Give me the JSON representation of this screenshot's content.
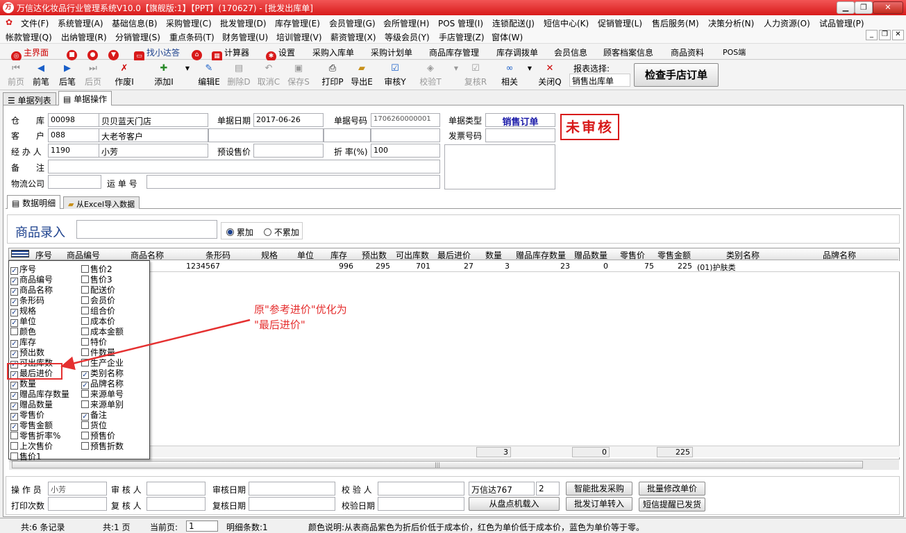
{
  "title": "万信达化妆品行业管理系统V10.0【旗舰版:1】【PPT】(170627) - [批发出库单]",
  "menu1": [
    "文件(F)",
    "系统管理(A)",
    "基础信息(B)",
    "采购管理(C)",
    "批发管理(D)",
    "库存管理(E)",
    "会员管理(G)",
    "会所管理(H)",
    "POS 管理(I)",
    "连锁配送(J)",
    "短信中心(K)",
    "促销管理(L)",
    "售后服务(M)",
    "决策分析(N)",
    "人力资源(O)",
    "试品管理(P)"
  ],
  "menu2": [
    "帐款管理(Q)",
    "出纳管理(R)",
    "分销管理(S)",
    "重点条码(T)",
    "财务管理(U)",
    "培训管理(V)",
    "薪资管理(X)",
    "等级会员(Y)",
    "手店管理(Z)",
    "窗体(W)"
  ],
  "quick": [
    "主界面",
    "找小达答",
    "计算器",
    "设置",
    "采购入库单",
    "采购计划单",
    "商品库存管理",
    "库存调拨单",
    "会员信息",
    "顾客档案信息",
    "商品资料",
    "POS端"
  ],
  "toolbar": [
    "前页",
    "前笔",
    "后笔",
    "后页",
    "作废I",
    "添加I",
    "编辑E",
    "删除D",
    "取消C",
    "保存S",
    "打印P",
    "导出E",
    "审核Y",
    "校验T",
    "复核R",
    "相关",
    "关闭Q"
  ],
  "report_label": "报表选择:",
  "report_value": "销售出库单",
  "check_btn": "检查手店订单",
  "tabs": [
    "单据列表",
    "单据操作"
  ],
  "header": {
    "warehouse_label": "仓　　库",
    "warehouse_code": "00098",
    "warehouse_name": "贝贝蓝天门店",
    "customer_label": "客　　户",
    "customer_code": "088",
    "customer_name": "大老爷客户",
    "handler_label": "经 办 人",
    "handler_code": "1190",
    "handler_name": "小芳",
    "remark_label": "备　　注",
    "logistics_label": "物流公司",
    "waybill_label": "运 单 号",
    "date_label": "单据日期",
    "date_value": "2017-06-26",
    "preset_label": "预设售价",
    "no_label": "单据号码",
    "no_value": "1706260000001",
    "discount_label": "折 率(%)",
    "discount_value": "100",
    "type_label": "单据类型",
    "type_value": "销售订单",
    "invoice_label": "发票号码",
    "stamp": "未审核"
  },
  "subtabs": [
    "数据明细",
    "从Excel导入数据"
  ],
  "entry_label": "商品录入",
  "radio": [
    "累加",
    "不累加"
  ],
  "columns": [
    "序号",
    "商品编号",
    "商品名称",
    "条形码",
    "规格",
    "单位",
    "库存",
    "预出数",
    "可出库数",
    "最后进价",
    "数量",
    "赠品库存数量",
    "赠品数量",
    "零售价",
    "零售金额",
    "类别名称",
    "品牌名称"
  ],
  "row": {
    "barcode": "1234567",
    "stock": "996",
    "pre": "295",
    "avail": "701",
    "last_price": "27",
    "qty": "3",
    "gift_stock": "23",
    "gift_qty": "0",
    "retail": "75",
    "amount": "225",
    "category": "(01)护肤类"
  },
  "totals": {
    "qty": "3",
    "gift_qty": "0",
    "amount": "225"
  },
  "col_left": [
    {
      "t": "序号",
      "c": true
    },
    {
      "t": "商品编号",
      "c": true
    },
    {
      "t": "商品名称",
      "c": true
    },
    {
      "t": "条形码",
      "c": true
    },
    {
      "t": "规格",
      "c": true
    },
    {
      "t": "单位",
      "c": true
    },
    {
      "t": "颜色",
      "c": false
    },
    {
      "t": "库存",
      "c": true
    },
    {
      "t": "预出数",
      "c": true
    },
    {
      "t": "可出库数",
      "c": true
    },
    {
      "t": "最后进价",
      "c": true
    },
    {
      "t": "数量",
      "c": true
    },
    {
      "t": "赠品库存数量",
      "c": true
    },
    {
      "t": "赠品数量",
      "c": true
    },
    {
      "t": "零售价",
      "c": true
    },
    {
      "t": "零售金额",
      "c": true
    },
    {
      "t": "零售折率%",
      "c": false
    },
    {
      "t": "上次售价",
      "c": false
    },
    {
      "t": "售价1",
      "c": false
    }
  ],
  "col_right": [
    {
      "t": "售价2",
      "c": false
    },
    {
      "t": "售价3",
      "c": false
    },
    {
      "t": "配送价",
      "c": false
    },
    {
      "t": "会员价",
      "c": false
    },
    {
      "t": "组合价",
      "c": false
    },
    {
      "t": "成本价",
      "c": false
    },
    {
      "t": "成本金额",
      "c": false
    },
    {
      "t": "特价",
      "c": false
    },
    {
      "t": "件数量",
      "c": false
    },
    {
      "t": "生产企业",
      "c": false
    },
    {
      "t": "类别名称",
      "c": true
    },
    {
      "t": "品牌名称",
      "c": true
    },
    {
      "t": "来源单号",
      "c": false
    },
    {
      "t": "来源单别",
      "c": false
    },
    {
      "t": "备注",
      "c": true
    },
    {
      "t": "货位",
      "c": false
    },
    {
      "t": "预售价",
      "c": false
    },
    {
      "t": "预售折数",
      "c": false
    }
  ],
  "annotation_line1": "原\"参考进价\"优化为",
  "annotation_line2": "\"最后进价\"",
  "footer": {
    "operator_label": "操 作 员",
    "operator_value": "小芳",
    "print_label": "打印次数",
    "auditor_label": "审 核 人",
    "reviewer_label": "复 核 人",
    "audit_date_label": "审核日期",
    "review_date_label": "复核日期",
    "checker_label": "校 验 人",
    "check_date_label": "校验日期",
    "company": "万信达767",
    "count": "2",
    "btn1": "智能批发采购",
    "btn2": "批量修改单价",
    "btn3": "从盘点机载入",
    "btn4": "批发订单转入",
    "btn5": "短信提醒已发货"
  },
  "status": {
    "records": "共:6 条记录",
    "pages": "共:1 页",
    "current_label": "当前页:",
    "current": "1",
    "detail": "明细条数:1",
    "legend": "颜色说明:从表商品紫色为折后价低于成本价，红色为单价低于成本价，蓝色为单价等于零。"
  }
}
